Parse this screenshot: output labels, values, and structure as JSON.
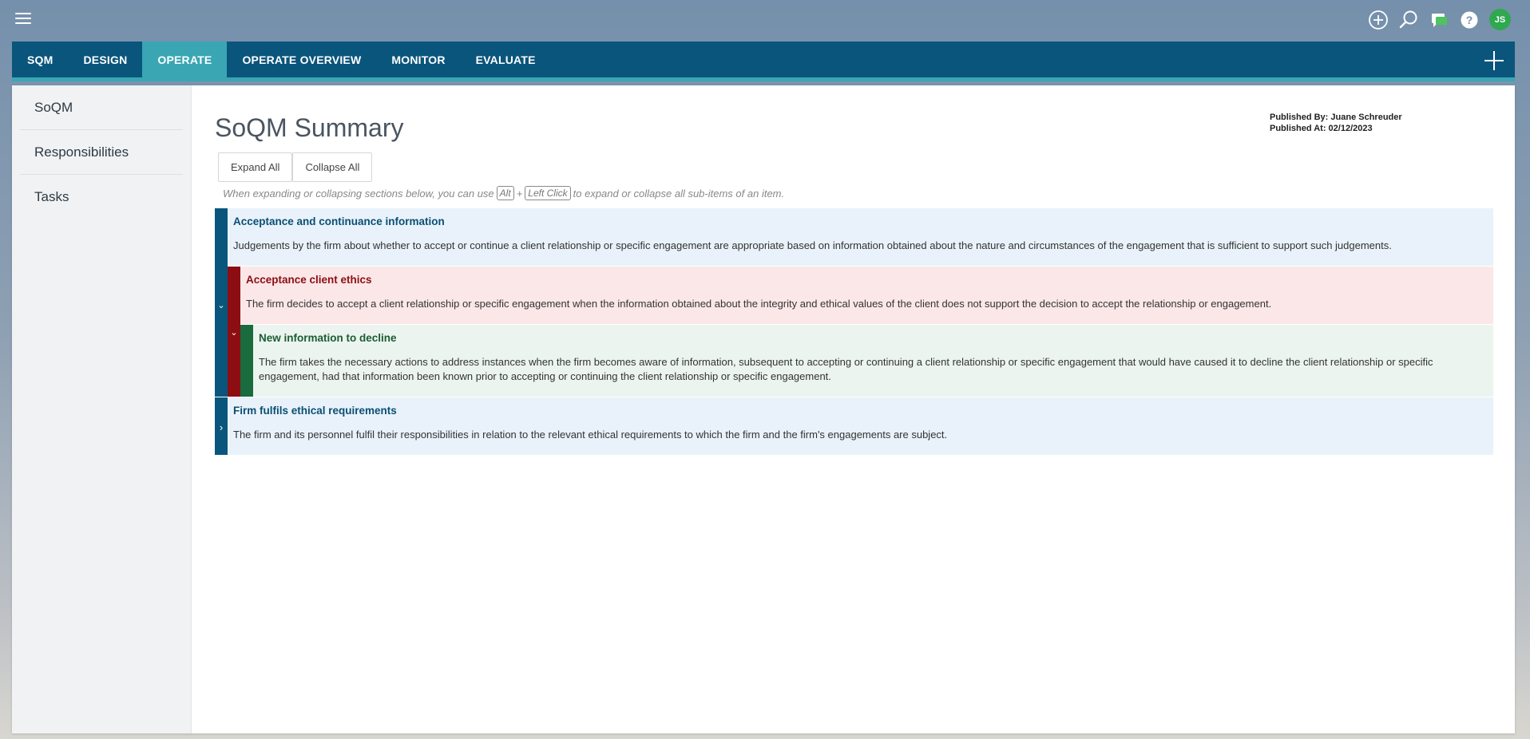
{
  "user": {
    "initials": "JS"
  },
  "nav": {
    "tabs": [
      {
        "label": "SQM"
      },
      {
        "label": "DESIGN"
      },
      {
        "label": "OPERATE",
        "active": true
      },
      {
        "label": "OPERATE OVERVIEW"
      },
      {
        "label": "MONITOR"
      },
      {
        "label": "EVALUATE"
      }
    ]
  },
  "sidebar": {
    "items": [
      {
        "label": "SoQM"
      },
      {
        "label": "Responsibilities"
      },
      {
        "label": "Tasks"
      }
    ]
  },
  "main": {
    "title": "SoQM Summary",
    "published_by": "Published By: Juane Schreuder",
    "published_at": "Published At: 02/12/2023",
    "expand_label": "Expand All",
    "collapse_label": "Collapse All",
    "hint": {
      "before": "When expanding or collapsing sections below, you can use",
      "key1": "Alt",
      "plus": "+",
      "key2": "Left Click",
      "after": "to expand or collapse all sub-items of an item."
    }
  },
  "tree": {
    "item1": {
      "title": "Acceptance and continuance information",
      "description": "Judgements by the firm about whether to accept or continue a client relationship or specific engagement are appropriate based on information obtained about the nature and circumstances of the engagement that is sufficient to support such judgements.",
      "child": {
        "title": "Acceptance client ethics",
        "description": "The firm decides to accept a client relationship or specific engagement when the information obtained about the integrity and ethical values of the client does not support the decision to accept the relationship or engagement.",
        "child": {
          "title": "New information to decline",
          "description": "The firm takes the necessary actions to address instances when the firm becomes aware of information, subsequent to accepting or continuing a client relationship or specific engagement that would have caused it to decline the client relationship or specific engagement, had that information been known prior to accepting or continuing the client relationship or specific engagement."
        }
      }
    },
    "item2": {
      "title": "Firm fulfils ethical requirements",
      "description": "The firm and its personnel fulfil their responsibilities in relation to the relevant ethical requirements to which the firm and the firm's engagements are subject."
    }
  },
  "colors": {
    "nav_bg": "#0a557c",
    "nav_active": "#3aa6b4",
    "level1": "#0a557c",
    "level2": "#8c0e12",
    "level3": "#1a6b3d"
  },
  "icons": [
    "hamburger-icon",
    "add-circle-icon",
    "search-icon",
    "chat-icon",
    "help-icon",
    "plus-icon",
    "chevron-down-icon",
    "chevron-right-icon"
  ]
}
